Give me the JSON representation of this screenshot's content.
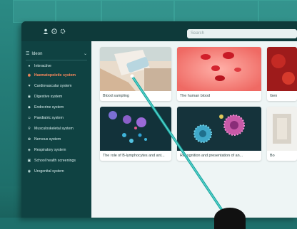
{
  "search": {
    "placeholder": "Search"
  },
  "sidebar": {
    "category": "Ideon",
    "items": [
      {
        "label": "Interactive",
        "icon": "circle-icon",
        "active": false
      },
      {
        "label": "Haematopoietic system",
        "icon": "drop-icon",
        "active": true
      },
      {
        "label": "Cardiovascular system",
        "icon": "heart-icon",
        "active": false
      },
      {
        "label": "Digestive system",
        "icon": "stomach-icon",
        "active": false
      },
      {
        "label": "Endocrine system",
        "icon": "gland-icon",
        "active": false
      },
      {
        "label": "Paediatric system",
        "icon": "child-icon",
        "active": false
      },
      {
        "label": "Musculoskeletal system",
        "icon": "bone-icon",
        "active": false
      },
      {
        "label": "Nervous system",
        "icon": "brain-icon",
        "active": false
      },
      {
        "label": "Respiratory system",
        "icon": "lungs-icon",
        "active": false
      },
      {
        "label": "School health screenings",
        "icon": "school-icon",
        "active": false
      },
      {
        "label": "Urogenital system",
        "icon": "kidney-icon",
        "active": false
      }
    ]
  },
  "cards": {
    "c1": {
      "title": "Blood sampling"
    },
    "c2": {
      "title": "The human blood"
    },
    "c3": {
      "title": "Gen"
    },
    "c4": {
      "title": "The role of B-lymphocytes and ant..."
    },
    "c5": {
      "title": "Recognition and presentation of an..."
    },
    "c6": {
      "title": "Bo"
    }
  },
  "colors": {
    "accent": "#ff8a5c",
    "panel": "#0f4242",
    "content": "#eef5f5",
    "laser": "#1aa6a0"
  }
}
